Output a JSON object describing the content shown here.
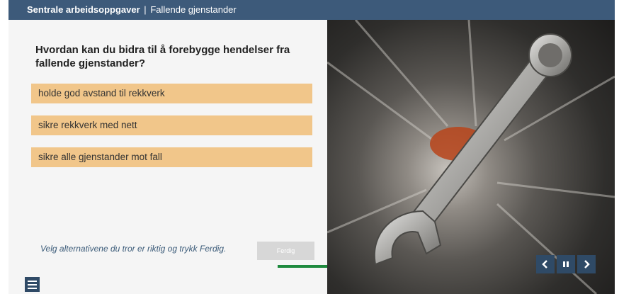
{
  "header": {
    "course": "Sentrale arbeidsoppgaver",
    "separator": "|",
    "topic": "Fallende gjenstander"
  },
  "quiz": {
    "question": "Hvordan kan du bidra til å forebygge hendelser fra fallende gjenstander?",
    "options": [
      "holde god avstand til rekkverk",
      "sikre rekkverk med nett",
      "sikre alle gjenstander mot fall"
    ],
    "instruction": "Velg alternativene du tror er riktig og trykk Ferdig.",
    "done_label": "Ferdig"
  },
  "footer": {
    "menu_icon": "hamburger-menu-icon",
    "prev_icon": "chevron-left-icon",
    "pause_icon": "pause-icon",
    "next_icon": "chevron-right-icon"
  },
  "colors": {
    "header_bg": "#3d5a7a",
    "option_bg": "#f1c68a",
    "button_dark": "#2f4a66",
    "progress": "#1e8a3e",
    "done_disabled": "#d7d7d7"
  }
}
